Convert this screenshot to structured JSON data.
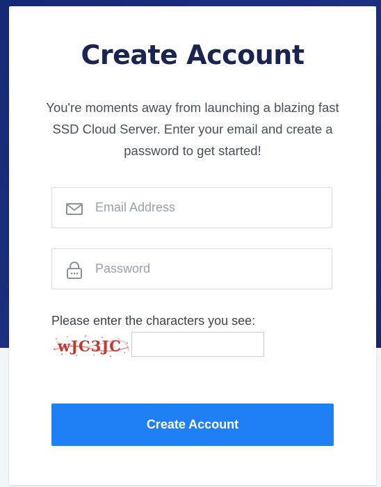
{
  "page": {
    "title": "Create Account",
    "subtitle": "You're moments away from launching a blazing fast SSD Cloud Server. Enter your email and create a password to get started!"
  },
  "form": {
    "email": {
      "placeholder": "Email Address",
      "value": "",
      "icon": "envelope-icon"
    },
    "password": {
      "placeholder": "Password",
      "value": "",
      "icon": "lock-icon"
    },
    "captcha": {
      "label": "Please enter the characters you see:",
      "image_text": "wJC3JC",
      "value": ""
    },
    "submit_label": "Create Account"
  },
  "colors": {
    "background_top": "#1c2f80",
    "title": "#1a2450",
    "button": "#1f80f6",
    "field_border": "#d7dae0",
    "placeholder": "#9aa0ab",
    "captcha_text": "#c0392b"
  }
}
